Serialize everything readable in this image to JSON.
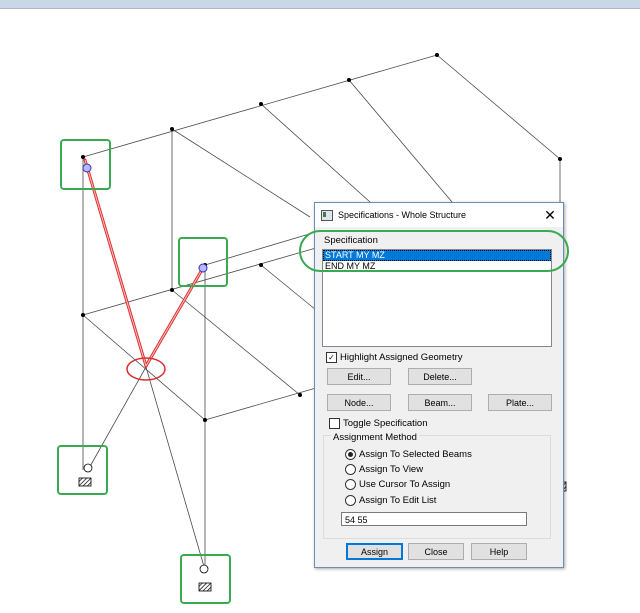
{
  "dialog": {
    "title": "Specifications - Whole Structure",
    "close_glyph": "✕",
    "specification_label": "Specification",
    "specifications": [
      {
        "label": "START MY MZ",
        "selected": true
      },
      {
        "label": "END MY MZ",
        "selected": false
      }
    ],
    "highlight_label": "Highlight Assigned Geometry",
    "highlight_checked": true,
    "buttons": {
      "edit": "Edit...",
      "delete": "Delete...",
      "node": "Node...",
      "beam": "Beam...",
      "plate": "Plate...",
      "assign": "Assign",
      "close": "Close",
      "help": "Help"
    },
    "toggle_label": "Toggle Specification",
    "toggle_checked": false,
    "assignment_method_label": "Assignment Method",
    "methods": [
      {
        "label": "Assign To Selected Beams",
        "selected": true
      },
      {
        "label": "Assign To View",
        "selected": false
      },
      {
        "label": "Use Cursor To Assign",
        "selected": false
      },
      {
        "label": "Assign To Edit List",
        "selected": false
      }
    ],
    "edit_list_value": "54 55"
  },
  "colors": {
    "highlight_green": "#3aaa52",
    "member_red": "#e03030",
    "selection_blue": "#0078d7"
  }
}
